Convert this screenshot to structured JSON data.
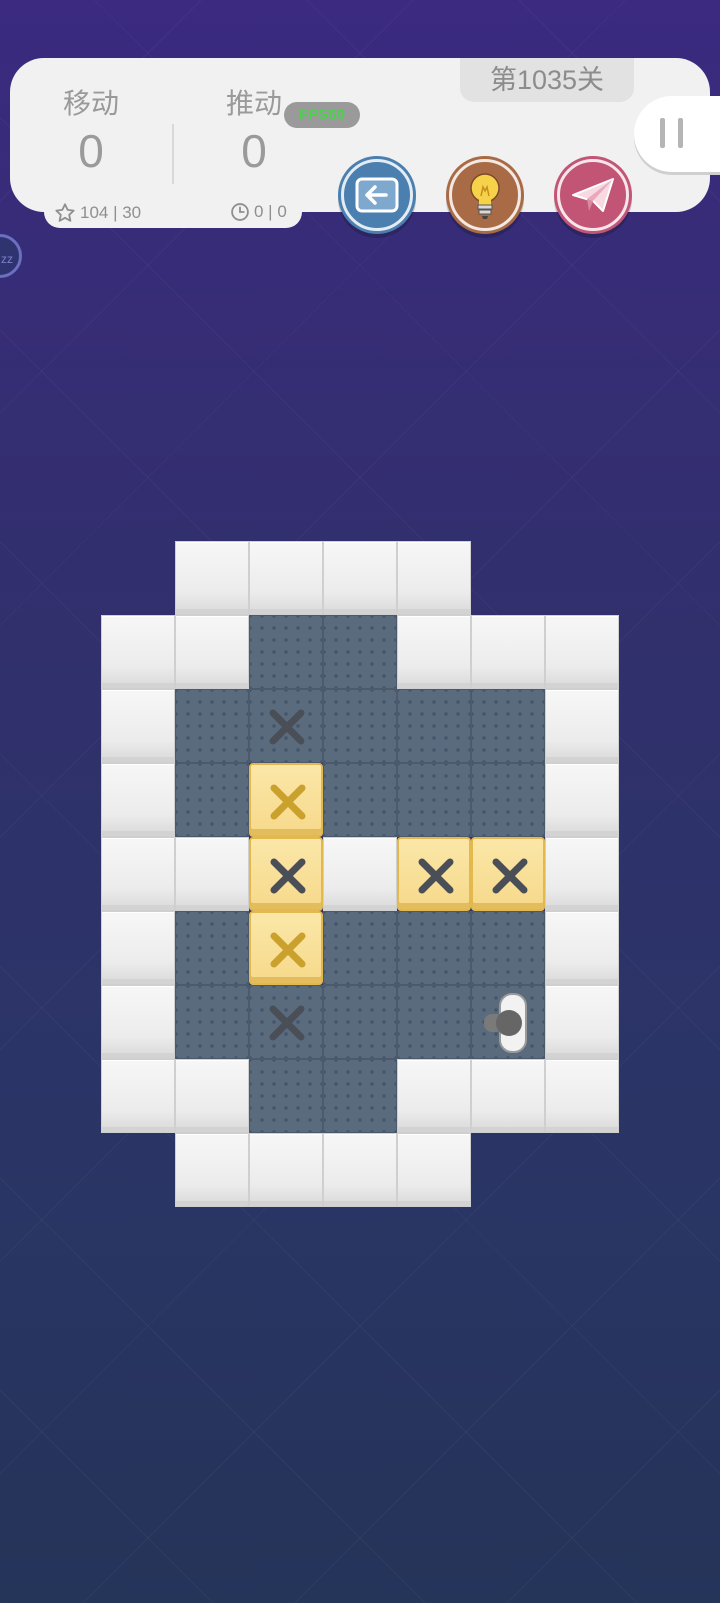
{
  "level": {
    "label": "第1035关"
  },
  "stats": {
    "moves": {
      "label": "移动",
      "value": "0"
    },
    "pushes": {
      "label": "推动",
      "value": "0"
    }
  },
  "fps_badge": "FPS60",
  "sub_info": {
    "stars": {
      "icon": "star-outline-icon",
      "text": "104 | 30"
    },
    "timer": {
      "icon": "clock-icon",
      "text": "0 | 0"
    }
  },
  "buttons": {
    "undo": {
      "icon": "undo-arrow-icon",
      "color": "#4a7fb0"
    },
    "hint": {
      "icon": "lightbulb-icon",
      "color": "#a86b46"
    },
    "share": {
      "icon": "paper-plane-icon",
      "color": "#c25575"
    },
    "pause": {
      "icon": "pause-icon"
    }
  },
  "sleep_badge": {
    "icon": "zz-icon",
    "text": "zz"
  },
  "board": {
    "legend": {
      "#": "wall",
      ".": "floor",
      "t": "target",
      "B": "box-on-target",
      "w": "wall-inner",
      "p": "player",
      "_": "empty"
    },
    "rows": [
      "_####__",
      "##..###",
      "#.t...#",
      "#.B...#",
      "#wBwBB#",
      "#.B...#",
      "#.t..p#",
      "##..###",
      "_####__"
    ],
    "colors": {
      "floor": "#5a6b7e",
      "wall": "#f1f1f1",
      "box": "#f6d98b",
      "target_mark": "#4a4f57",
      "box_mark": "#c9a12c"
    }
  }
}
